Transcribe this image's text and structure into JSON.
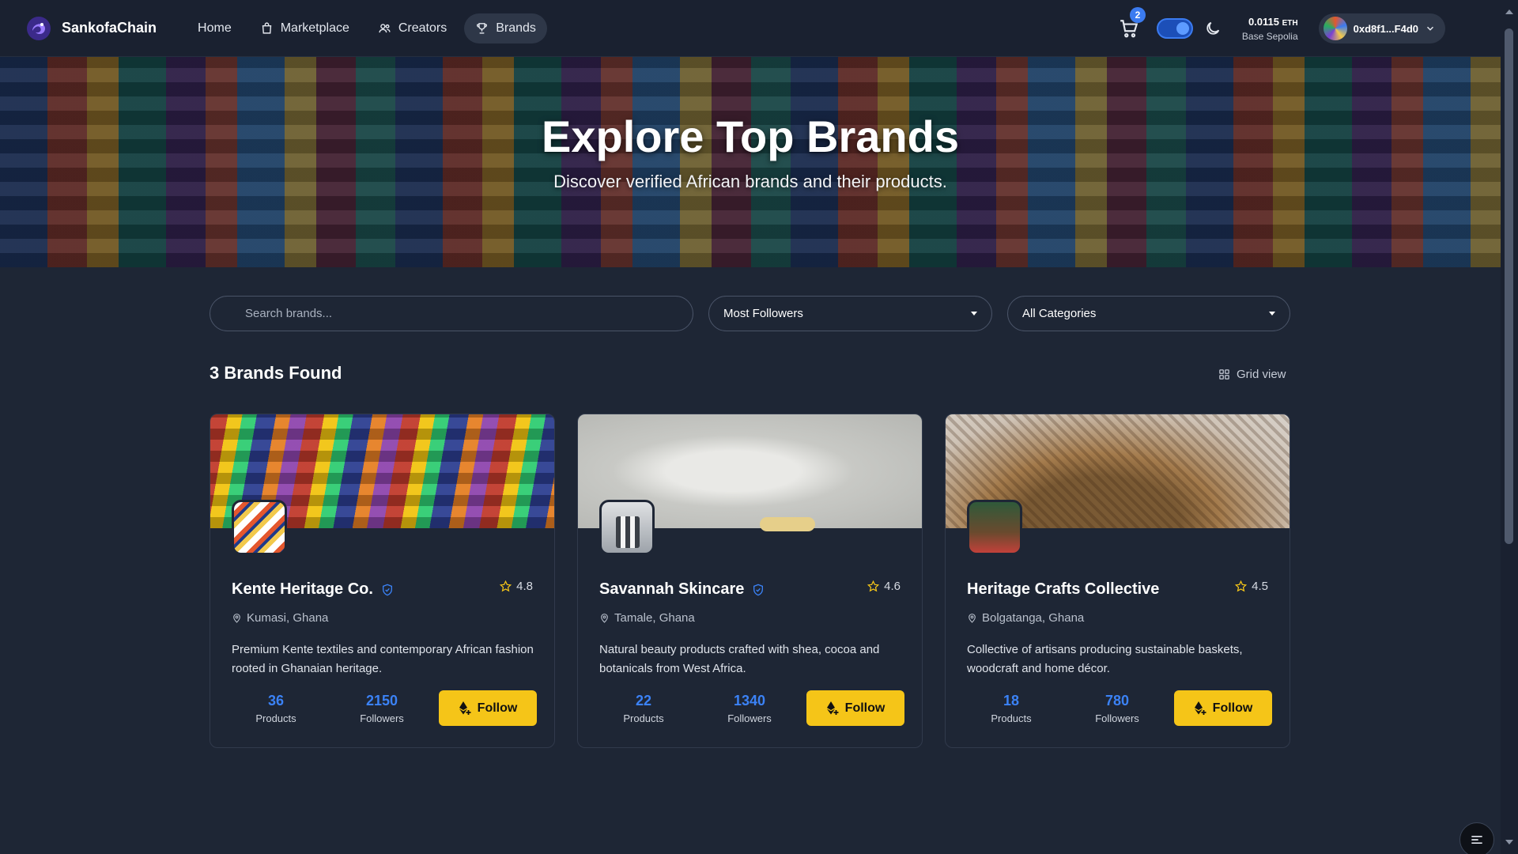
{
  "nav": {
    "brand": "SankofaChain",
    "links": [
      {
        "label": "Home",
        "icon": "none"
      },
      {
        "label": "Marketplace",
        "icon": "bag-icon"
      },
      {
        "label": "Creators",
        "icon": "users-icon"
      },
      {
        "label": "Brands",
        "icon": "trophy-icon",
        "active": true
      }
    ],
    "cart_count": "2",
    "balance": "0.0115",
    "balance_unit": "ETH",
    "network": "Base Sepolia",
    "account": "0xd8f1...F4d0"
  },
  "hero": {
    "title": "Explore Top Brands",
    "subtitle": "Discover verified African brands and their products."
  },
  "filters": {
    "search_placeholder": "Search brands...",
    "sort": "Most Followers",
    "category": "All Categories"
  },
  "results": {
    "title": "3 Brands Found",
    "view_label": "Grid view"
  },
  "brands": [
    {
      "name": "Kente Heritage Co.",
      "verified": true,
      "rating": "4.8",
      "location": "Kumasi, Ghana",
      "description": "Premium Kente textiles and contemporary African fashion rooted in Ghanaian heritage.",
      "products": "36",
      "products_label": "Products",
      "followers": "2150",
      "followers_label": "Followers",
      "button": "Follow"
    },
    {
      "name": "Savannah Skincare",
      "verified": true,
      "rating": "4.6",
      "location": "Tamale, Ghana",
      "description": "Natural beauty products crafted with shea, cocoa and botanicals from West Africa.",
      "products": "22",
      "products_label": "Products",
      "followers": "1340",
      "followers_label": "Followers",
      "button": "Follow"
    },
    {
      "name": "Heritage Crafts Collective",
      "verified": false,
      "rating": "4.5",
      "location": "Bolgatanga, Ghana",
      "description": "Collective of artisans producing sustainable baskets, woodcraft and home décor.",
      "products": "18",
      "products_label": "Products",
      "followers": "780",
      "followers_label": "Followers",
      "button": "Follow"
    }
  ],
  "colors": {
    "accent": "#3b82f6",
    "follow": "#f5c518",
    "background": "#1e2635"
  }
}
